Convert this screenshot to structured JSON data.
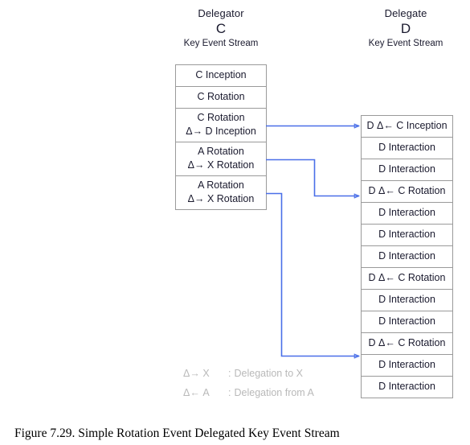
{
  "figure": {
    "caption": "Figure 7.29.  Simple Rotation Event Delegated Key Event Stream"
  },
  "columns": {
    "left": {
      "role": "Delegator",
      "letter": "C",
      "subtitle": "Key Event Stream",
      "events": [
        {
          "line1": "C Inception",
          "line2": ""
        },
        {
          "line1": "C Rotation",
          "line2": ""
        },
        {
          "line1": "C Rotation",
          "line2": "Δ→ D Inception"
        },
        {
          "line1": "A Rotation",
          "line2": "Δ→ X Rotation"
        },
        {
          "line1": "A Rotation",
          "line2": "Δ→ X Rotation"
        }
      ]
    },
    "right": {
      "role": "Delegate",
      "letter": "D",
      "subtitle": "Key Event Stream",
      "events": [
        {
          "line1": "D Δ← C Inception",
          "line2": ""
        },
        {
          "line1": "D Interaction",
          "line2": ""
        },
        {
          "line1": "D Interaction",
          "line2": ""
        },
        {
          "line1": "D Δ← C Rotation",
          "line2": ""
        },
        {
          "line1": "D Interaction",
          "line2": ""
        },
        {
          "line1": "D Interaction",
          "line2": ""
        },
        {
          "line1": "D Interaction",
          "line2": ""
        },
        {
          "line1": "D Δ← C Rotation",
          "line2": ""
        },
        {
          "line1": "D Interaction",
          "line2": ""
        },
        {
          "line1": "D Interaction",
          "line2": ""
        },
        {
          "line1": "D Δ← C Rotation",
          "line2": ""
        },
        {
          "line1": "D Interaction",
          "line2": ""
        },
        {
          "line1": "D Interaction",
          "line2": ""
        }
      ]
    }
  },
  "connectors": {
    "color": "#4a6fe8",
    "links": [
      {
        "from_event": "C Rotation Δ→ D Inception",
        "to_event": "D Δ← C Inception"
      },
      {
        "from_event": "A Rotation Δ→ X Rotation",
        "to_event": "D Δ← C Rotation"
      },
      {
        "from_event": "A Rotation Δ→ X Rotation",
        "to_event": "D Δ← C Rotation"
      }
    ]
  },
  "legend": {
    "rows": [
      {
        "symbol": "Δ→ X",
        "colon": ":",
        "text": "Delegation to X"
      },
      {
        "symbol": "Δ← A",
        "colon": ":",
        "text": "Delegation from A"
      }
    ],
    "color": "#b9b9b9"
  }
}
